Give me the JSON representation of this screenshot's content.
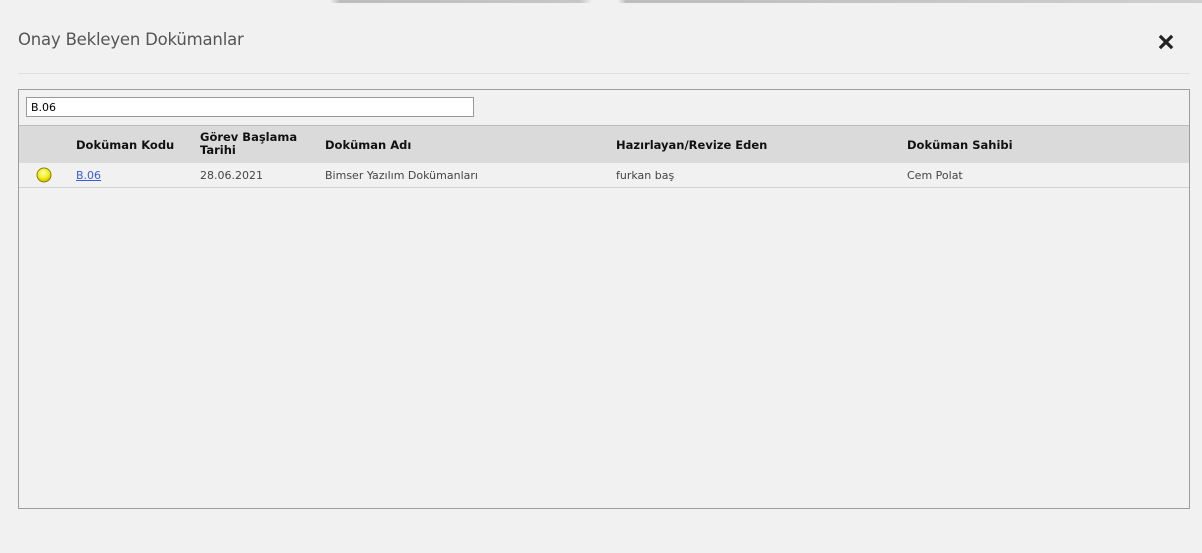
{
  "modal": {
    "title": "Onay Bekleyen Dokümanlar",
    "close_icon": "close-icon"
  },
  "search": {
    "value": "B.06"
  },
  "table": {
    "columns": [
      "Doküman Kodu",
      "Görev Başlama Tarihi",
      "Doküman Adı",
      "Hazırlayan/Revize Eden",
      "Doküman Sahibi"
    ],
    "rows": [
      {
        "status_icon": "yellow-circle-icon",
        "status_color": "#f4ee1b",
        "code": "B.06",
        "start_date": "28.06.2021",
        "name": "Bimser Yazılım Dokümanları",
        "prepared_by": "furkan baş",
        "owner": "Cem Polat"
      }
    ]
  },
  "colors": {
    "background": "#f1f1f1",
    "header_bg": "#dadada",
    "link": "#3c5dd6"
  }
}
